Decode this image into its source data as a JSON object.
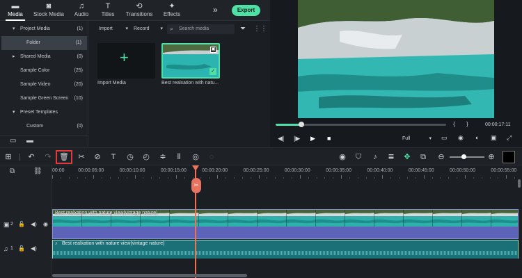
{
  "tabs": [
    {
      "label": "Media",
      "icon": "folder-icon",
      "active": true
    },
    {
      "label": "Stock Media",
      "icon": "stock-icon",
      "active": false
    },
    {
      "label": "Audio",
      "icon": "music-icon",
      "active": false
    },
    {
      "label": "Titles",
      "icon": "title-icon",
      "active": false
    },
    {
      "label": "Transitions",
      "icon": "transition-icon",
      "active": false
    },
    {
      "label": "Effects",
      "icon": "effects-icon",
      "active": false
    }
  ],
  "export_label": "Export",
  "sidebar": {
    "items": [
      {
        "label": "Project Media",
        "count": "(1)"
      },
      {
        "label": "Folder",
        "count": "(1)"
      },
      {
        "label": "Shared Media",
        "count": "(0)"
      },
      {
        "label": "Sample Color",
        "count": "(25)"
      },
      {
        "label": "Sample Video",
        "count": "(20)"
      },
      {
        "label": "Sample Green Screen",
        "count": "(10)"
      },
      {
        "label": "Preset Templates",
        "count": ""
      },
      {
        "label": "Custom",
        "count": "(0)"
      }
    ]
  },
  "media": {
    "import_dropdown": "Import",
    "record_dropdown": "Record",
    "search_placeholder": "Search media",
    "import_label": "Import Media",
    "clip_label": "Best realxation with natu..."
  },
  "preview": {
    "time": "00:00:17:11",
    "bracket_in": "{",
    "bracket_out": "}",
    "quality": "Full",
    "progress": 0.15
  },
  "ruler": {
    "ticks": [
      "00:00",
      "00:00:05:00",
      "00:00:10:00",
      "00:00:15:00",
      "00:00:20:00",
      "00:00:25:00",
      "00:00:30:00",
      "00:00:35:00",
      "00:00:40:00",
      "00:00:45:00",
      "00:00:50:00",
      "00:00:55:00"
    ]
  },
  "tracks": {
    "video_title": "Best realxation with nature view(vintage nature)",
    "audio_title": "Best realxation with nature view(vintage nature)",
    "video_num": "2",
    "audio_num": "1"
  },
  "colors": {
    "accent": "#4ee0a7",
    "playhead": "#e8735f",
    "video_track": "#5c63b8",
    "audio_track": "#1b6f77"
  }
}
